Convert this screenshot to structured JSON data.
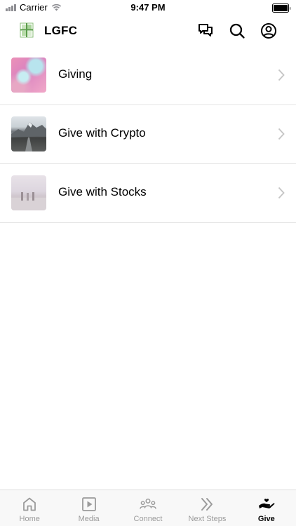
{
  "status_bar": {
    "carrier": "Carrier",
    "time": "9:47 PM"
  },
  "header": {
    "app_title": "LGFC",
    "icons": [
      "chat-icon",
      "search-icon",
      "profile-icon"
    ]
  },
  "give_list": {
    "items": [
      {
        "label": "Giving",
        "thumbnail": "giving-thumbnail"
      },
      {
        "label": "Give with Crypto",
        "thumbnail": "crypto-thumbnail"
      },
      {
        "label": "Give with Stocks",
        "thumbnail": "stocks-thumbnail"
      }
    ]
  },
  "tab_bar": {
    "tabs": [
      {
        "label": "Home",
        "icon": "home-icon"
      },
      {
        "label": "Media",
        "icon": "media-play-icon"
      },
      {
        "label": "Connect",
        "icon": "people-group-icon"
      },
      {
        "label": "Next Steps",
        "icon": "double-chevron-icon"
      },
      {
        "label": "Give",
        "icon": "giving-hand-icon"
      }
    ],
    "active_tab": "Give"
  },
  "colors": {
    "active_tab_text": "#000000",
    "inactive_tab_text": "#9b9b9b",
    "chevron": "#c4c4c4",
    "divider": "#e4e4e4"
  }
}
